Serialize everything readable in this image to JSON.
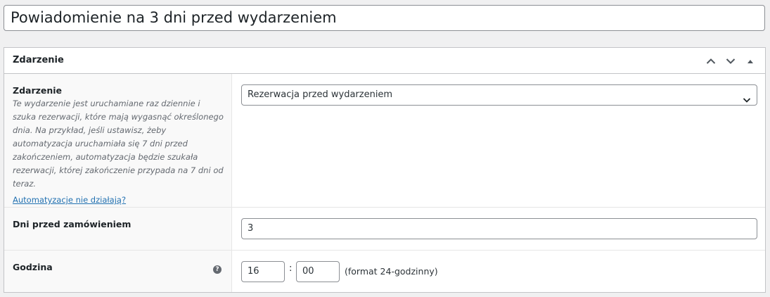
{
  "title": {
    "value": "Powiadomienie na 3 dni przed wydarzeniem"
  },
  "box": {
    "heading": "Zdarzenie",
    "icons": [
      "chevron-up-icon",
      "chevron-down-icon",
      "triangle-up-icon"
    ]
  },
  "event_row": {
    "label": "Zdarzenie",
    "description": "Te wydarzenie jest uruchamiane raz dziennie i szuka rezerwacji, które mają wygasnąć określonego dnia. Na przykład, jeśli ustawisz, żeby automatyzacja uruchamiała się 7 dni przed zakończeniem, automatyzacja będzie szukała rezerwacji, której zakończenie przypada na 7 dni od teraz.",
    "link": "Automatyzacje nie działają?",
    "selected": "Rezerwacja przed wydarzeniem"
  },
  "days_row": {
    "label": "Dni przed zamówieniem",
    "value": "3"
  },
  "time_row": {
    "label": "Godzina",
    "hours": "16",
    "separator": ":",
    "minutes": "00",
    "hint": "(format 24-godzinny)",
    "help_icon": "?"
  }
}
